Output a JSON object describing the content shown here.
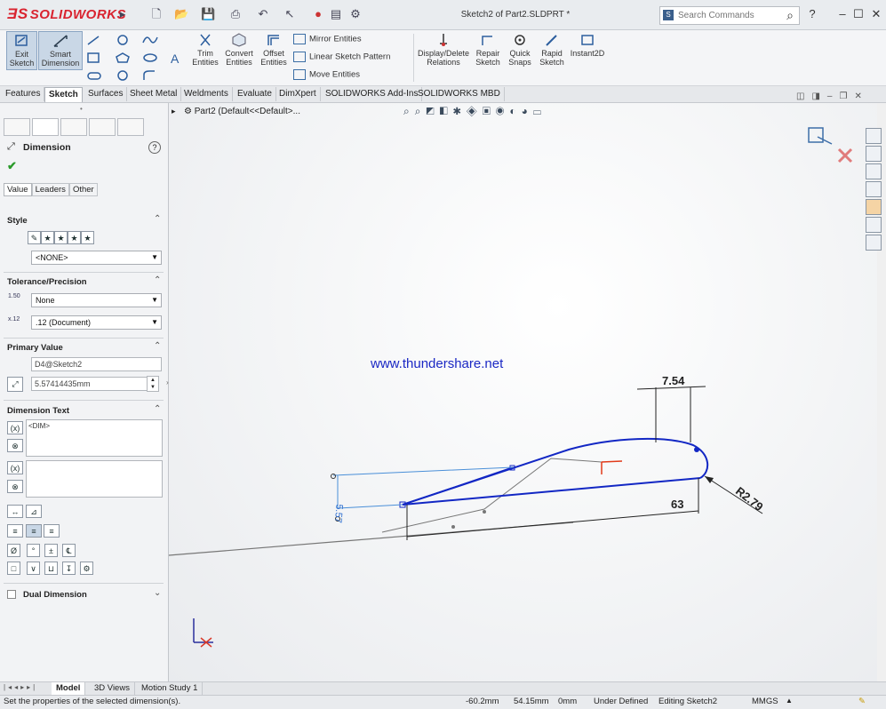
{
  "app": {
    "logo": "SOLIDWORKS",
    "doc_title": "Sketch2 of Part2.SLDPRT *"
  },
  "search": {
    "placeholder": "Search Commands"
  },
  "ribbon": {
    "exit_sketch": "Exit Sketch",
    "smart_dimension": "Smart Dimension",
    "trim_entities": "Trim Entities",
    "convert_entities": "Convert Entities",
    "offset_entities": "Offset Entities",
    "mirror_entities": "Mirror Entities",
    "linear_sketch_pattern": "Linear Sketch Pattern",
    "move_entities": "Move Entities",
    "display_delete_relations": "Display/Delete Relations",
    "repair_sketch": "Repair Sketch",
    "quick_snaps": "Quick Snaps",
    "rapid_sketch": "Rapid Sketch",
    "instant2d": "Instant2D"
  },
  "tabs": [
    "Features",
    "Sketch",
    "Surfaces",
    "Sheet Metal",
    "Weldments",
    "Evaluate",
    "DimXpert",
    "SOLIDWORKS Add-Ins",
    "SOLIDWORKS MBD"
  ],
  "panel": {
    "title": "Dimension",
    "subtabs": [
      "Value",
      "Leaders",
      "Other"
    ],
    "style_label": "Style",
    "style_value": "<NONE>",
    "tolerance_label": "Tolerance/Precision",
    "tolerance_value": "None",
    "precision_value": ".12 (Document)",
    "primary_label": "Primary Value",
    "primary_name": "D4@Sketch2",
    "primary_value": "5.57414435mm",
    "dimtext_label": "Dimension Text",
    "dimtext_value": "<DIM>",
    "dual_label": "Dual Dimension"
  },
  "graphics": {
    "breadcrumb": "Part2  (Default<<Default>...",
    "watermark": "www.thundershare.net",
    "dims": {
      "d1": "7.54",
      "d2": "5.57",
      "d3": "63",
      "d4": "R2.79"
    }
  },
  "bottom_tabs": [
    "Model",
    "3D Views",
    "Motion Study 1"
  ],
  "status": {
    "message": "Set the properties of the selected dimension(s).",
    "x": "-60.2mm",
    "y": "54.15mm",
    "z": "0mm",
    "state": "Under Defined",
    "editing": "Editing Sketch2",
    "units": "MMGS"
  }
}
